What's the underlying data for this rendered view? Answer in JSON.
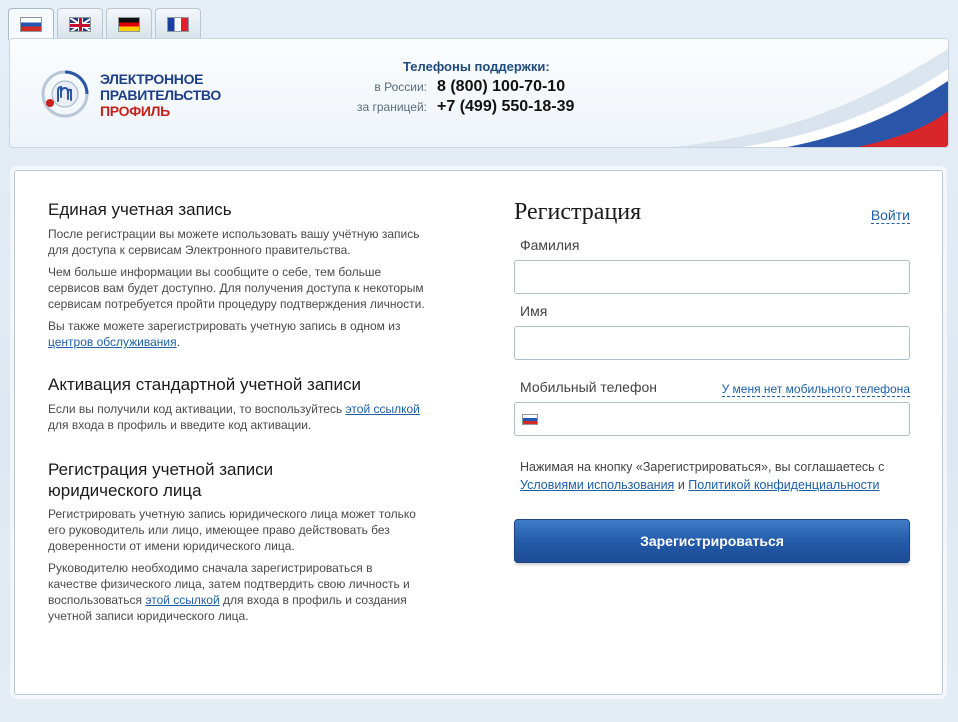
{
  "languages": [
    {
      "code": "ru",
      "icon": "flag-russia-icon",
      "active": true
    },
    {
      "code": "en",
      "icon": "flag-uk-icon",
      "active": false
    },
    {
      "code": "de",
      "icon": "flag-germany-icon",
      "active": false
    },
    {
      "code": "fr",
      "icon": "flag-france-icon",
      "active": false
    }
  ],
  "header": {
    "logo_lines": [
      "ЭЛЕКТРОННОЕ",
      "ПРАВИТЕЛЬСТВО",
      "ПРОФИЛЬ"
    ],
    "support_title": "Телефоны поддержки:",
    "support_russia_label": "в России:",
    "support_russia_number": "8 (800) 100-70-10",
    "support_abroad_label": "за границей:",
    "support_abroad_number": "+7 (499) 550-18-39"
  },
  "info": {
    "s1_title": "Единая учетная запись",
    "s1_p1": "После регистрации вы можете использовать вашу учётную запись для доступа к сервисам Электронного правительства.",
    "s1_p2": "Чем больше информации вы сообщите о себе, тем больше сервисов вам будет доступно. Для получения доступа к некоторым сервисам потребуется пройти процедуру подтверждения личности.",
    "s1_p3_text": "Вы также можете зарегистрировать учетную запись в одном из",
    "s1_p3_link": "центров обслуживания",
    "s1_p3_end": ".",
    "s2_title": "Активация стандартной учетной записи",
    "s2_p1_text": "Если вы получили код активации, то воспользуйтесь",
    "s2_p1_link": "этой ссылкой",
    "s2_p1_end": "для входа в профиль и введите код активации.",
    "s3_title": "Регистрация учетной записи юридического лица",
    "s3_p1": "Регистрировать учетную запись юридического лица может только его руководитель или лицо, имеющее право действовать без доверенности от имени юридического лица.",
    "s3_p2_text": "Руководителю необходимо сначала зарегистрироваться в качестве физического лица, затем подтвердить свою личность и воспользоваться",
    "s3_p2_link": "этой ссылкой",
    "s3_p2_end": "для входа в профиль и создания учетной записи юридического лица."
  },
  "form": {
    "title": "Регистрация",
    "login_link": "Войти",
    "lastname_label": "Фамилия",
    "lastname_value": "",
    "firstname_label": "Имя",
    "firstname_value": "",
    "phone_label": "Мобильный телефон",
    "no_phone_link": "У меня нет мобильного телефона",
    "phone_value": "",
    "consent_text": "Нажимая на кнопку «Зарегистрироваться», вы соглашаетесь с",
    "terms_link": "Условиями использования",
    "consent_and": "и",
    "privacy_link": "Политикой конфиденциальности",
    "submit_label": "Зарегистрироваться"
  },
  "colors": {
    "brand_blue": "#1e3f86",
    "brand_red": "#c8201a",
    "link": "#1d5fa8",
    "button": "#2259a8"
  }
}
